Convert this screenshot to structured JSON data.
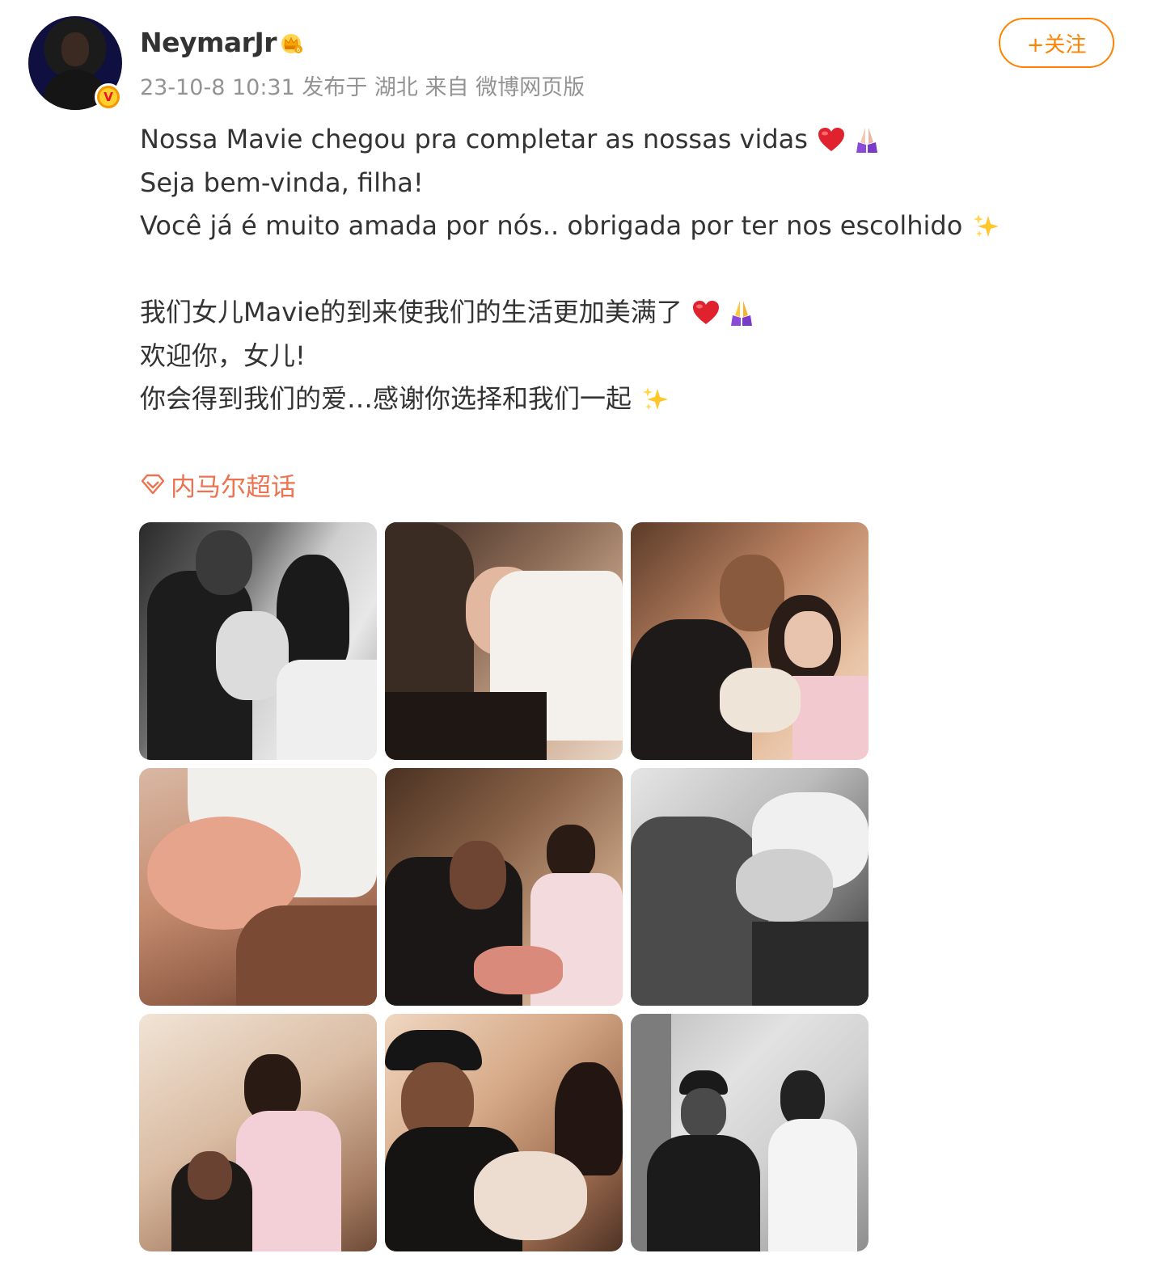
{
  "user": {
    "name": "NeymarJr",
    "avatar_icon": "avatar-image",
    "verified_icon": "verified-v-badge",
    "verified_letter": "V",
    "badge_icon": "crown-member-icon"
  },
  "meta": {
    "text": "23-10-8 10:31  发布于 湖北  来自 微博网页版"
  },
  "follow_button": {
    "label": "+关注"
  },
  "post": {
    "lines": [
      "Nossa Mavie chegou pra completar as nossas vidas",
      "Seja bem-vinda, filha!",
      "Você já é muito amada por nós.. obrigada por ter nos escolhido",
      "我们女儿Mavie的到来使我们的生活更加美满了",
      "欢迎你，女儿!",
      "你会得到我们的爱…感谢你选择和我们一起"
    ]
  },
  "topic": {
    "label": "内马尔超话",
    "icon": "diamond-topic-icon"
  },
  "photos": [
    {
      "name": "photo-1",
      "tone": "bw"
    },
    {
      "name": "photo-2",
      "tone": "warm"
    },
    {
      "name": "photo-3",
      "tone": "warm"
    },
    {
      "name": "photo-4",
      "tone": "warm"
    },
    {
      "name": "photo-5",
      "tone": "warm"
    },
    {
      "name": "photo-6",
      "tone": "bw"
    },
    {
      "name": "photo-7",
      "tone": "warm"
    },
    {
      "name": "photo-8",
      "tone": "warm"
    },
    {
      "name": "photo-9",
      "tone": "bw"
    }
  ],
  "colors": {
    "accent_orange": "#ff8200",
    "topic_color": "#eb7350",
    "meta_gray": "#939393",
    "text": "#333333"
  }
}
